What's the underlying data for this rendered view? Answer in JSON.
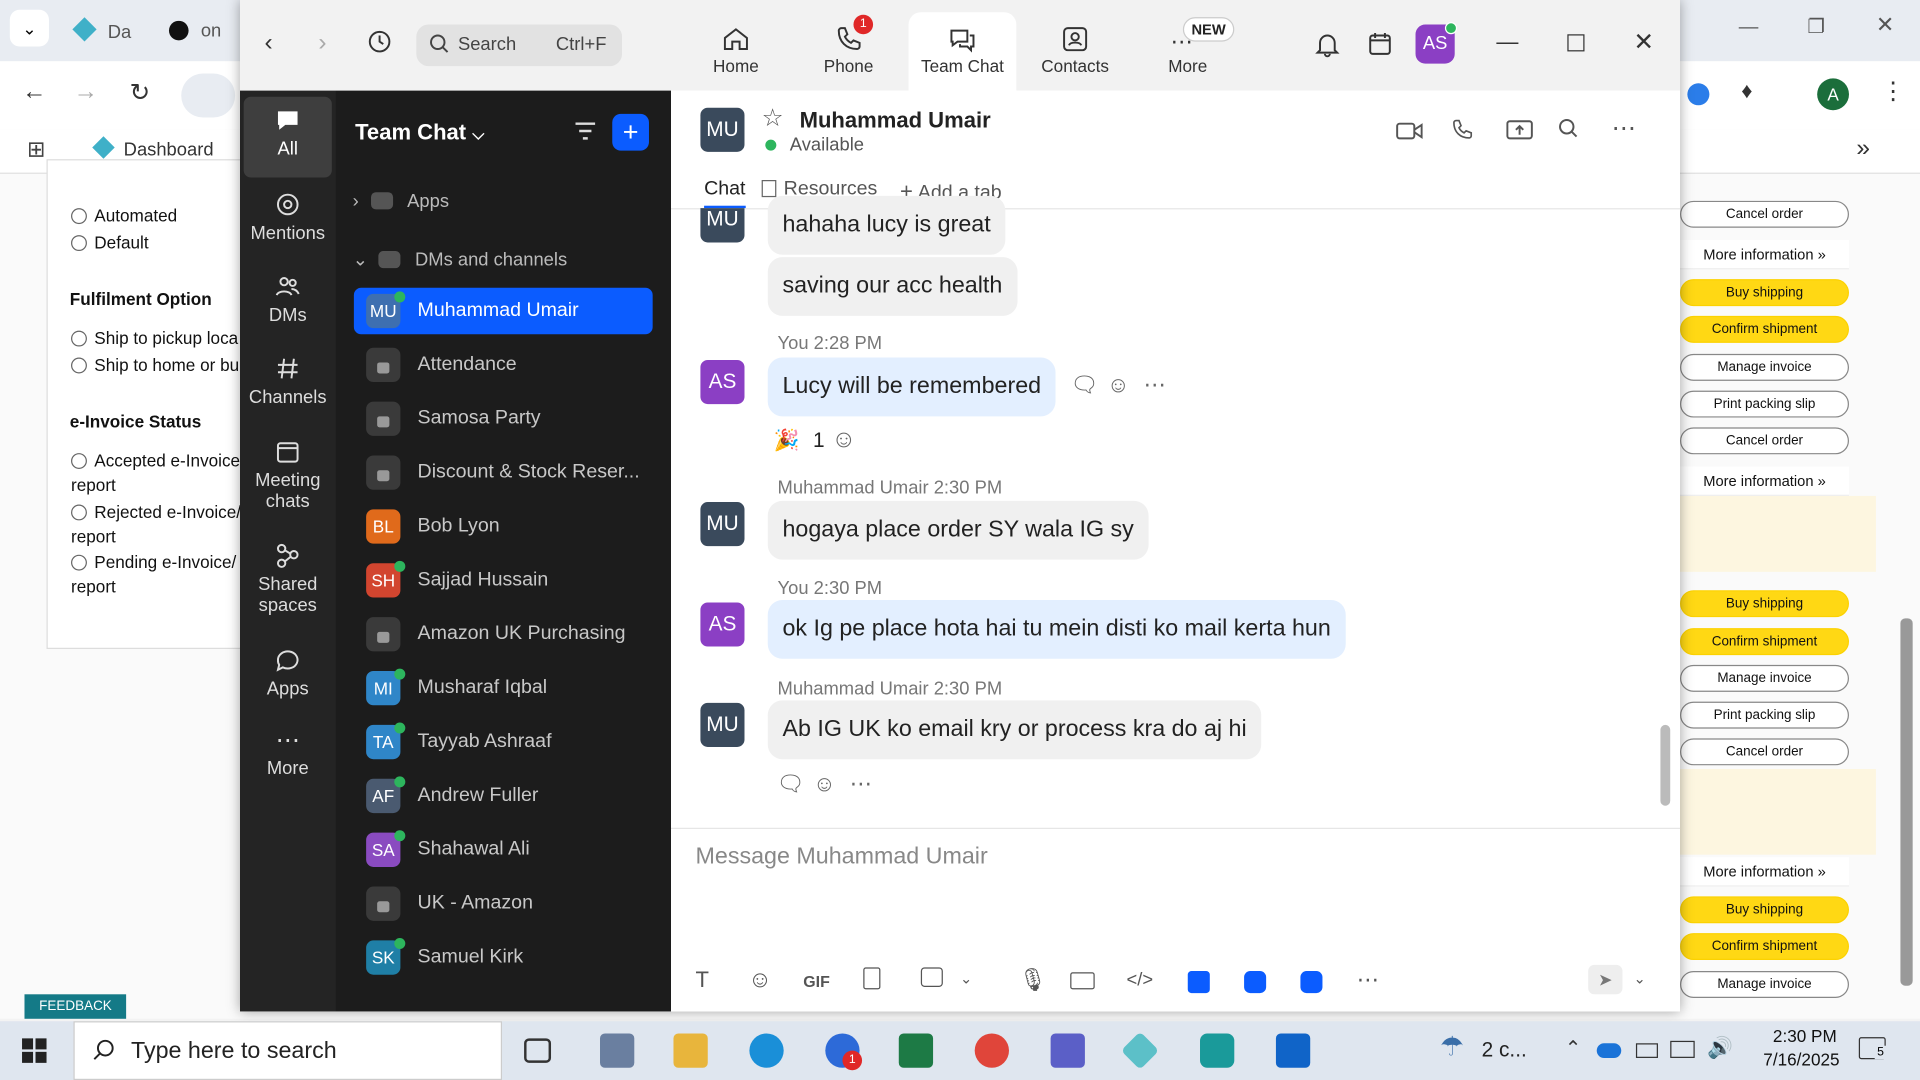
{
  "browser": {
    "tabs": [
      "Da",
      "on"
    ],
    "bookmark": "Dashboard",
    "profile_initial": "A"
  },
  "page": {
    "options_top": [
      "Automated",
      "Default"
    ],
    "fulfilment_heading": "Fulfilment Option",
    "fulfilment_options": [
      "Ship to pickup loca",
      "Ship to home or bu"
    ],
    "einvoice_heading": "e-Invoice Status",
    "einvoice_options": [
      [
        "Accepted e-Invoice",
        "report"
      ],
      [
        "Rejected e-Invoice/",
        "report"
      ],
      [
        "Pending e-Invoice/",
        "report"
      ]
    ],
    "feedback": "FEEDBACK",
    "right_buttons": {
      "cancel": "Cancel order",
      "more": "More information",
      "buy": "Buy shipping",
      "confirm": "Confirm shipment",
      "manage": "Manage invoice",
      "print": "Print packing slip"
    }
  },
  "zoom": {
    "search_placeholder": "Search",
    "search_shortcut": "Ctrl+F",
    "nav": [
      {
        "label": "Home"
      },
      {
        "label": "Phone",
        "badge": "1"
      },
      {
        "label": "Team Chat"
      },
      {
        "label": "Contacts"
      },
      {
        "label": "More",
        "badge": "NEW"
      }
    ],
    "user_initials": "AS",
    "rail": [
      {
        "label": "All"
      },
      {
        "label": "Mentions"
      },
      {
        "label": "DMs"
      },
      {
        "label": "Channels"
      },
      {
        "label": "Meeting chats"
      },
      {
        "label": "Shared spaces"
      },
      {
        "label": "Apps"
      },
      {
        "label": "More"
      }
    ],
    "sidebar": {
      "title": "Team Chat",
      "sections": [
        "Apps",
        "DMs and channels"
      ],
      "items": [
        {
          "initials": "MU",
          "name": "Muhammad Umair",
          "color": "#3e6fb0",
          "online": true
        },
        {
          "initials": "",
          "name": "Attendance",
          "color": "",
          "online": false
        },
        {
          "initials": "",
          "name": "Samosa Party",
          "color": "",
          "online": false
        },
        {
          "initials": "",
          "name": "Discount & Stock Reser...",
          "color": "",
          "online": false
        },
        {
          "initials": "BL",
          "name": "Bob Lyon",
          "color": "#e06a1b",
          "online": false
        },
        {
          "initials": "SH",
          "name": "Sajjad Hussain",
          "color": "#d2452f",
          "online": true
        },
        {
          "initials": "",
          "name": "Amazon UK Purchasing",
          "color": "",
          "online": false
        },
        {
          "initials": "MI",
          "name": "Musharaf Iqbal",
          "color": "#2f86c8",
          "online": true
        },
        {
          "initials": "TA",
          "name": "Tayyab Ashraaf",
          "color": "#2f86c8",
          "online": true
        },
        {
          "initials": "AF",
          "name": "Andrew Fuller",
          "color": "#4a5a70",
          "online": true
        },
        {
          "initials": "SA",
          "name": "Shahawal Ali",
          "color": "#8a4bc0",
          "online": true
        },
        {
          "initials": "",
          "name": "UK - Amazon",
          "color": "",
          "online": false
        },
        {
          "initials": "SK",
          "name": "Samuel Kirk",
          "color": "#1f7fa6",
          "online": true
        }
      ]
    },
    "chat": {
      "contact_initials": "MU",
      "contact_name": "Muhammad Umair",
      "status": "Available",
      "tabs": [
        "Chat",
        "Resources",
        "Add a tab"
      ],
      "messages": [
        {
          "text": "hahaha lucy is great"
        },
        {
          "text": "saving our acc health"
        },
        {
          "meta": "You 2:28 PM",
          "text": "Lucy will be remembered",
          "reaction": "1"
        },
        {
          "meta": "Muhammad Umair 2:30 PM",
          "text": "hogaya place order SY wala IG sy"
        },
        {
          "meta": "You 2:30 PM",
          "text": "ok Ig pe place hota hai tu mein disti ko mail kerta hun"
        },
        {
          "meta": "Muhammad Umair 2:30 PM",
          "text": "Ab IG UK ko email kry or process kra do aj hi"
        }
      ],
      "composer_placeholder": "Message Muhammad Umair",
      "gif_label": "GIF"
    }
  },
  "taskbar": {
    "search_placeholder": "Type here to search",
    "weather": "2 c...",
    "time": "2:30 PM",
    "date": "7/16/2025",
    "notifications": "5",
    "zoom_badge": "1"
  }
}
